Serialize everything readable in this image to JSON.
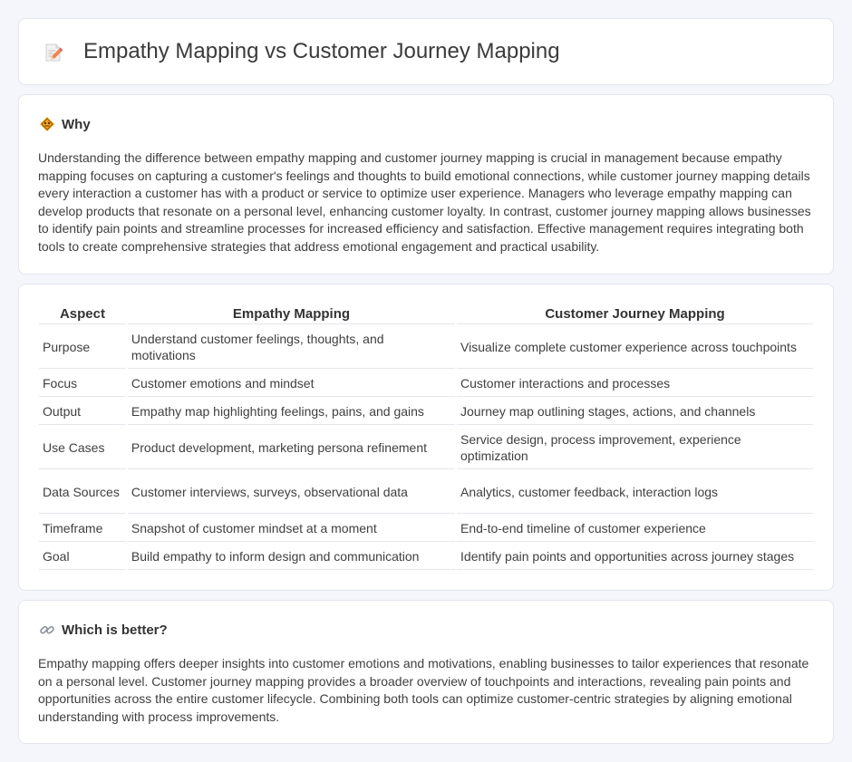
{
  "header": {
    "title": "Empathy Mapping vs Customer Journey Mapping",
    "icon": "document-pencil-icon"
  },
  "why": {
    "heading": "Why",
    "icon": "diamond-sign-icon",
    "text": "Understanding the difference between empathy mapping and customer journey mapping is crucial in management because empathy mapping focuses on capturing a customer's feelings and thoughts to build emotional connections, while customer journey mapping details every interaction a customer has with a product or service to optimize user experience. Managers who leverage empathy mapping can develop products that resonate on a personal level, enhancing customer loyalty. In contrast, customer journey mapping allows businesses to identify pain points and streamline processes for increased efficiency and satisfaction. Effective management requires integrating both tools to create comprehensive strategies that address emotional engagement and practical usability."
  },
  "comparison": {
    "headers": [
      "Aspect",
      "Empathy Mapping",
      "Customer Journey Mapping"
    ],
    "rows": [
      [
        "Purpose",
        "Understand customer feelings, thoughts, and motivations",
        "Visualize complete customer experience across touchpoints"
      ],
      [
        "Focus",
        "Customer emotions and mindset",
        "Customer interactions and processes"
      ],
      [
        "Output",
        "Empathy map highlighting feelings, pains, and gains",
        "Journey map outlining stages, actions, and channels"
      ],
      [
        "Use Cases",
        "Product development, marketing persona refinement",
        "Service design, process improvement, experience optimization"
      ],
      [
        "Data Sources",
        "Customer interviews, surveys, observational data",
        "Analytics, customer feedback, interaction logs"
      ],
      [
        "Timeframe",
        "Snapshot of customer mindset at a moment",
        "End-to-end timeline of customer experience"
      ],
      [
        "Goal",
        "Build empathy to inform design and communication",
        "Identify pain points and opportunities across journey stages"
      ]
    ]
  },
  "better": {
    "heading": "Which is better?",
    "icon": "link-icon",
    "text": "Empathy mapping offers deeper insights into customer emotions and motivations, enabling businesses to tailor experiences that resonate on a personal level. Customer journey mapping provides a broader overview of touchpoints and interactions, revealing pain points and opportunities across the entire customer lifecycle. Combining both tools can optimize customer-centric strategies by aligning emotional understanding with process improvements."
  }
}
